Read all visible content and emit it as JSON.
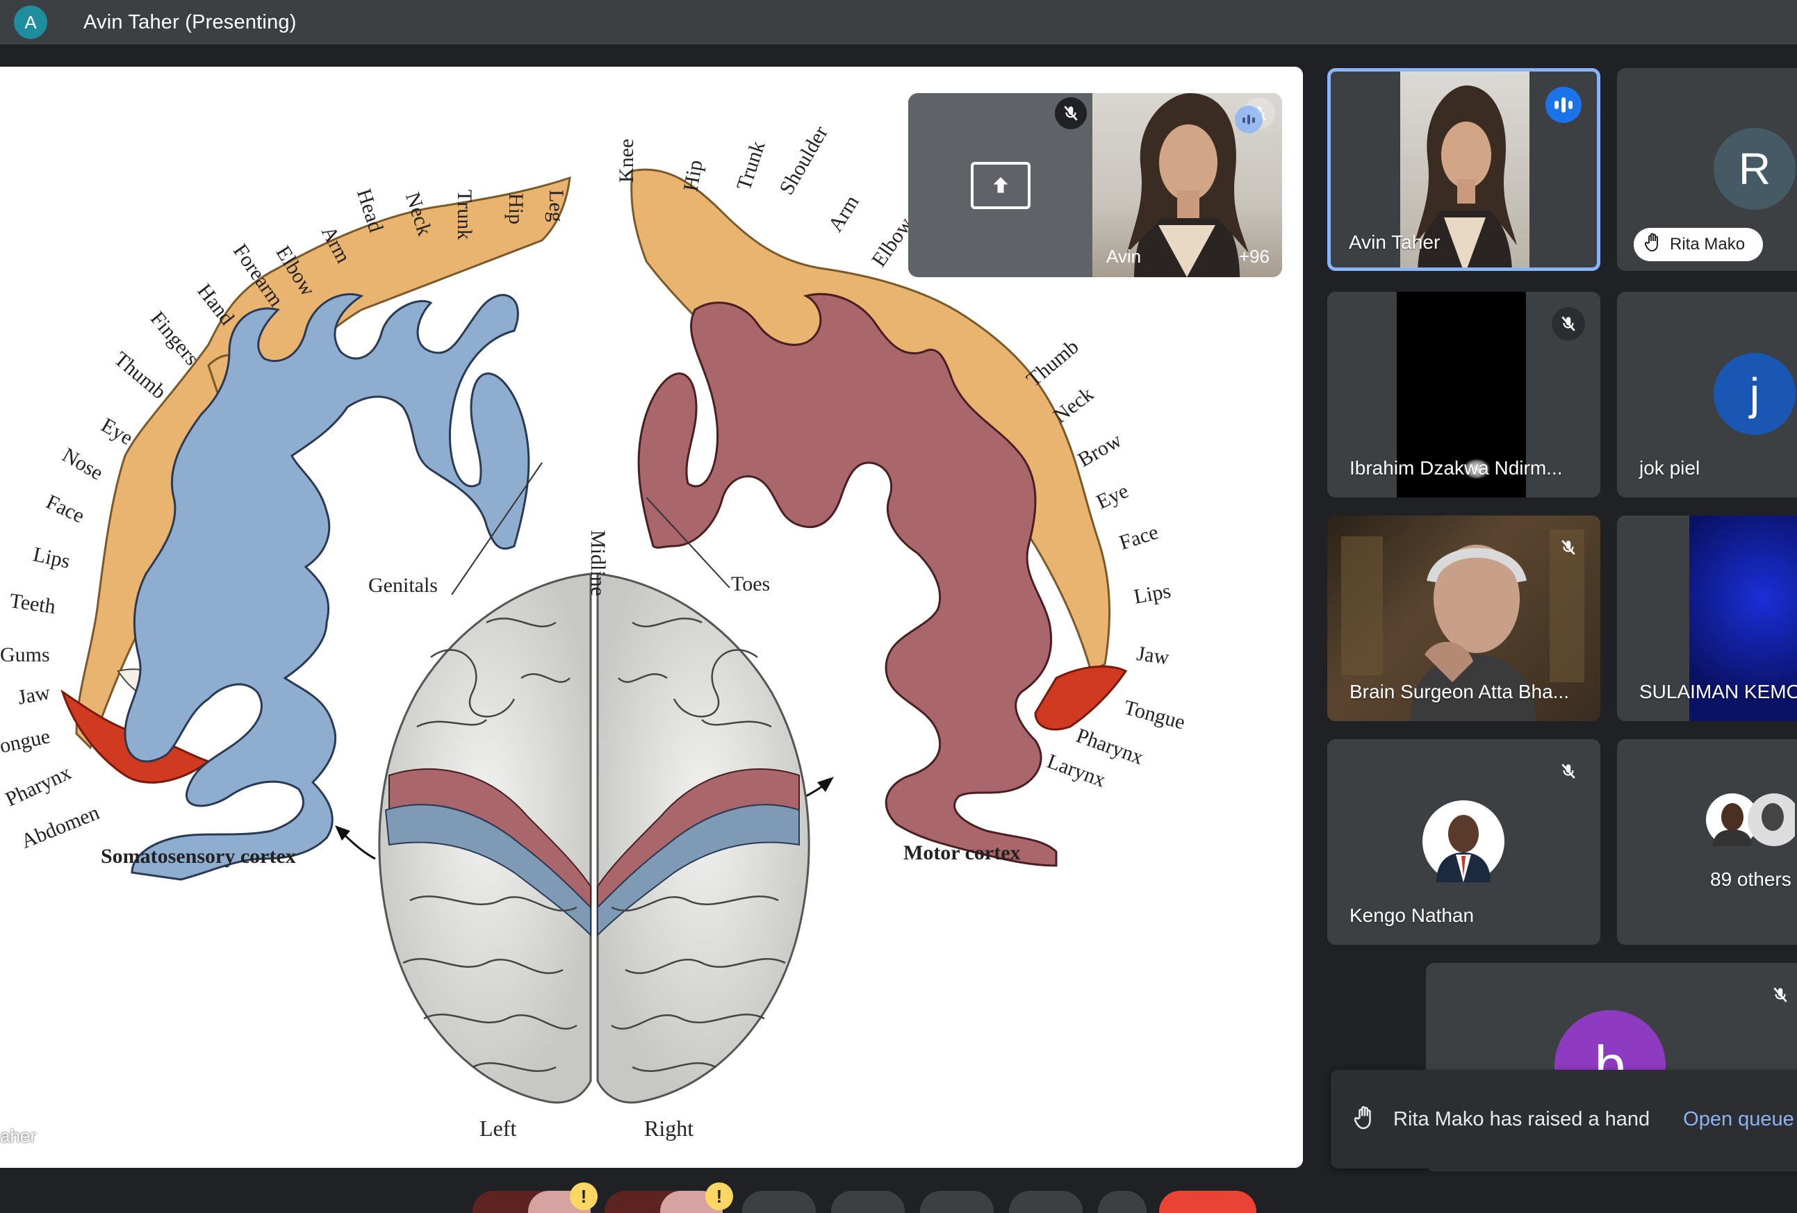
{
  "meeting": {
    "presenter_initial": "A",
    "title": "Avin Taher (Presenting)",
    "presenter_caption": "aher"
  },
  "slide": {
    "left_labels": [
      "Leg",
      "Hip",
      "Trunk",
      "Neck",
      "Head",
      "Arm",
      "Elbow",
      "Forearm",
      "Hand",
      "Fingers",
      "Thumb",
      "Eye",
      "Nose",
      "Face",
      "Lips",
      "Teeth",
      "Gums",
      "Jaw",
      "ongue",
      "Pharynx",
      "Abdomen"
    ],
    "right_labels": [
      "Knee",
      "Hip",
      "Trunk",
      "Shoulder",
      "Arm",
      "Elbow",
      "Thumb",
      "Neck",
      "Brow",
      "Eye",
      "Face",
      "Lips",
      "Jaw",
      "Tongue",
      "Pharynx",
      "Larynx"
    ],
    "genitals": "Genitals",
    "midline": "Midline",
    "toes": "Toes",
    "somatosensory": "Somatosensory cortex",
    "motor": "Motor cortex",
    "left": "Left",
    "right": "Right"
  },
  "self_view": {
    "name": "Avin",
    "extra_count": "+96",
    "share_icon": "present-screen-icon",
    "mic_icon": "mic-off-icon"
  },
  "tiles": {
    "avin": {
      "name": "Avin Taher",
      "status_icon": "speaking-indicator-icon"
    },
    "rita": {
      "initial": "R",
      "hand_label": "Rita Mako",
      "hand_icon": "raised-hand-icon",
      "avatar_color": "#455a64"
    },
    "ibrahim": {
      "name": "Ibrahim Dzakwa Ndirm...",
      "mic_icon": "mic-off-icon"
    },
    "jok": {
      "initial": "j",
      "name": "jok piel",
      "avatar_color": "#1a57b5"
    },
    "brain_surgeon": {
      "name": "Brain Surgeon Atta Bha...",
      "mic_icon": "mic-off-icon"
    },
    "sulaiman": {
      "name": "SULAIMAN KEMO"
    },
    "kengo": {
      "name": "Kengo Nathan",
      "mic_icon": "mic-off-icon"
    },
    "others": {
      "label": "89 others"
    },
    "bottom": {
      "initial": "b",
      "avatar_color": "#8e3bc1",
      "mic_icon": "mic-off-icon"
    }
  },
  "toast": {
    "icon": "raised-hand-icon",
    "text": "Rita Mako has raised a hand",
    "action": "Open queue"
  },
  "controls": {
    "badge_text": "!",
    "end_call_color": "#ea4335"
  }
}
